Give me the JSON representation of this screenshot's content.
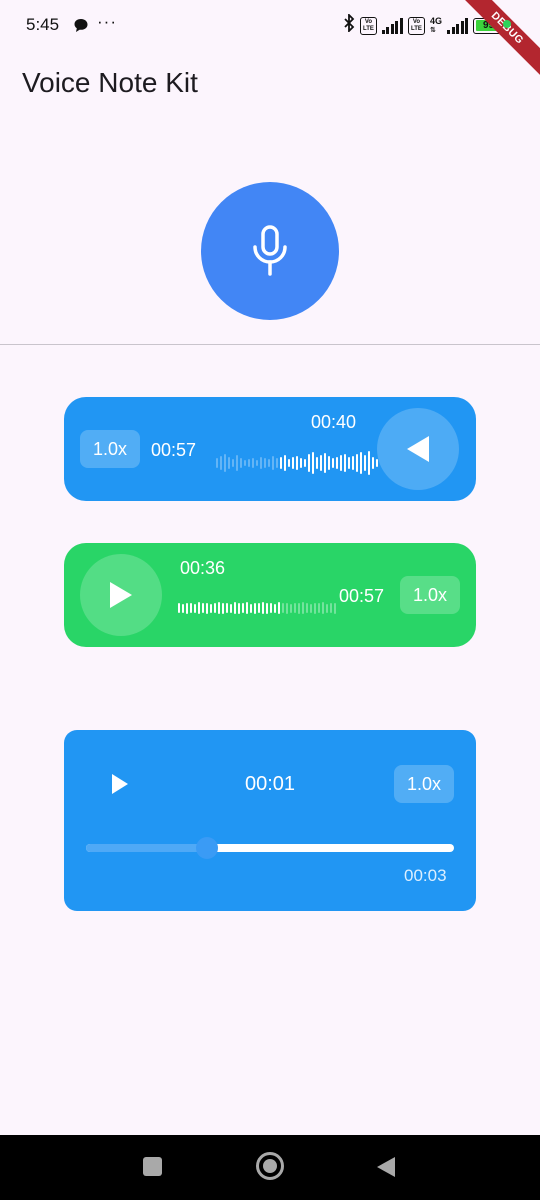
{
  "status_bar": {
    "time": "5:45",
    "dots": "···",
    "volte_1": [
      "Vo",
      "LTE"
    ],
    "volte_2": [
      "Vo",
      "LTE"
    ],
    "network": "4G",
    "battery": "99"
  },
  "debug_banner": "DEBUG",
  "app_bar": {
    "title": "Voice Note Kit"
  },
  "recorder": {
    "icon": "microphone-icon"
  },
  "blue_note": {
    "speed": "1.0x",
    "duration": "00:57",
    "position": "00:40",
    "progress": 0.7,
    "control_icon": "play-reversed-icon"
  },
  "green_note": {
    "position": "00:36",
    "duration": "00:57",
    "speed": "1.0x",
    "progress": 0.63,
    "control_icon": "play-icon"
  },
  "player": {
    "position": "00:01",
    "speed": "1.0x",
    "duration": "00:03",
    "progress": 0.33,
    "control_icon": "play-icon"
  },
  "colors": {
    "background": "#fcf5fd",
    "mic": "#4286f5",
    "blue_card": "#2196f3",
    "green_card": "#29d567",
    "debug": "#b3262f"
  },
  "nav_bar": {
    "recents": "square-icon",
    "home": "circle-icon",
    "back": "triangle-back-icon"
  }
}
